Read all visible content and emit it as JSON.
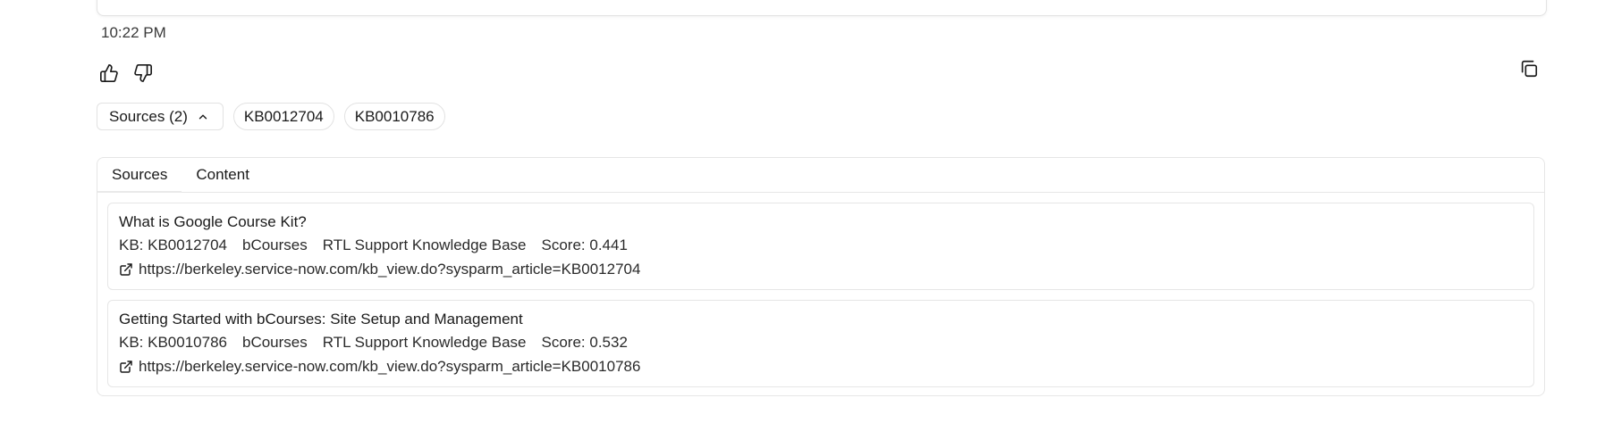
{
  "message": {
    "timestamp": "10:22 PM"
  },
  "icons": {
    "thumbs_up": "thumbs-up-icon",
    "thumbs_down": "thumbs-down-icon",
    "copy": "copy-icon",
    "chevron": "chevron-up-icon",
    "external_link": "external-link-icon"
  },
  "sources_bar": {
    "toggle_label": "Sources (2)",
    "chips": [
      "KB0012704",
      "KB0010786"
    ]
  },
  "panel": {
    "tabs": [
      {
        "label": "Sources",
        "active": true
      },
      {
        "label": "Content",
        "active": false
      }
    ],
    "sources": [
      {
        "title": "What is Google Course Kit?",
        "kb": "KB: KB0012704",
        "category": "bCourses",
        "knowledge_base": "RTL Support Knowledge Base",
        "score": "Score: 0.441",
        "url": "https://berkeley.service-now.com/kb_view.do?sysparm_article=KB0012704"
      },
      {
        "title": "Getting Started with bCourses: Site Setup and Management",
        "kb": "KB: KB0010786",
        "category": "bCourses",
        "knowledge_base": "RTL Support Knowledge Base",
        "score": "Score: 0.532",
        "url": "https://berkeley.service-now.com/kb_view.do?sysparm_article=KB0010786"
      }
    ]
  },
  "colors": {
    "border": "#e6e6e6",
    "text": "#1a1a1a",
    "background": "#ffffff"
  }
}
